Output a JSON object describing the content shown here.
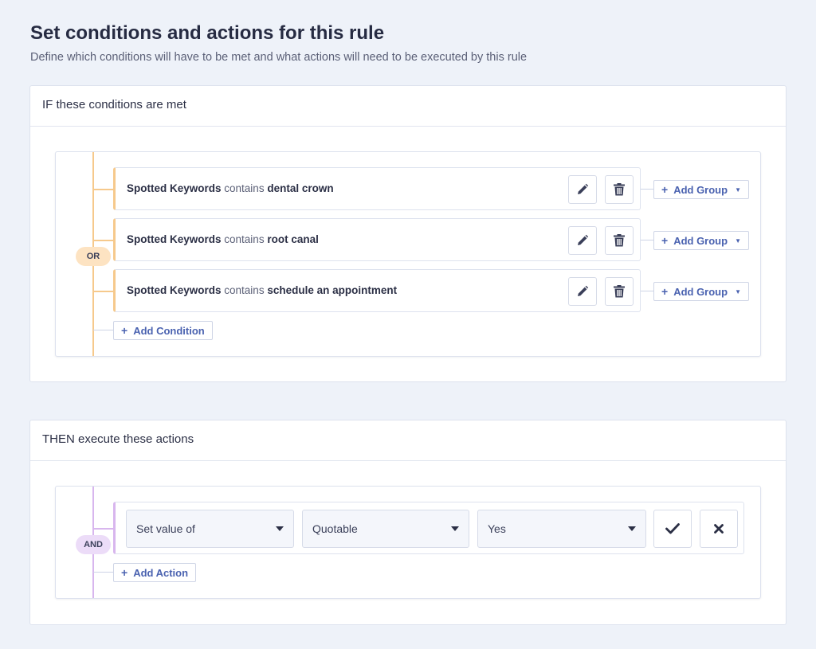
{
  "page": {
    "title": "Set conditions and actions for this rule",
    "subtitle": "Define which conditions will have to be met and what actions will need to be executed by this rule"
  },
  "conditions_card": {
    "header": "IF these conditions are met",
    "logic_operator": "OR",
    "logic_color": "#f6c98c",
    "pill_bg": "#fde3c2",
    "conditions": [
      {
        "field": "Spotted Keywords",
        "operator": "contains",
        "value": "dental crown",
        "edit_icon": "pencil-icon",
        "delete_icon": "trash-icon",
        "group_button": "Add Group"
      },
      {
        "field": "Spotted Keywords",
        "operator": "contains",
        "value": "root canal",
        "edit_icon": "pencil-icon",
        "delete_icon": "trash-icon",
        "group_button": "Add Group"
      },
      {
        "field": "Spotted Keywords",
        "operator": "contains",
        "value": "schedule an appointment",
        "edit_icon": "pencil-icon",
        "delete_icon": "trash-icon",
        "group_button": "Add Group"
      }
    ],
    "add_condition": "Add Condition"
  },
  "actions_card": {
    "header": "THEN execute these actions",
    "logic_operator": "AND",
    "logic_color": "#d8b6ee",
    "pill_bg": "#ecdcf8",
    "action": {
      "type_select": "Set value of",
      "field_select": "Quotable",
      "value_select": "Yes",
      "confirm_icon": "check-icon",
      "cancel_icon": "x-icon"
    },
    "add_action": "Add Action"
  },
  "colors": {
    "accent": "#4a62b0",
    "page_bg": "#eef2f9"
  }
}
